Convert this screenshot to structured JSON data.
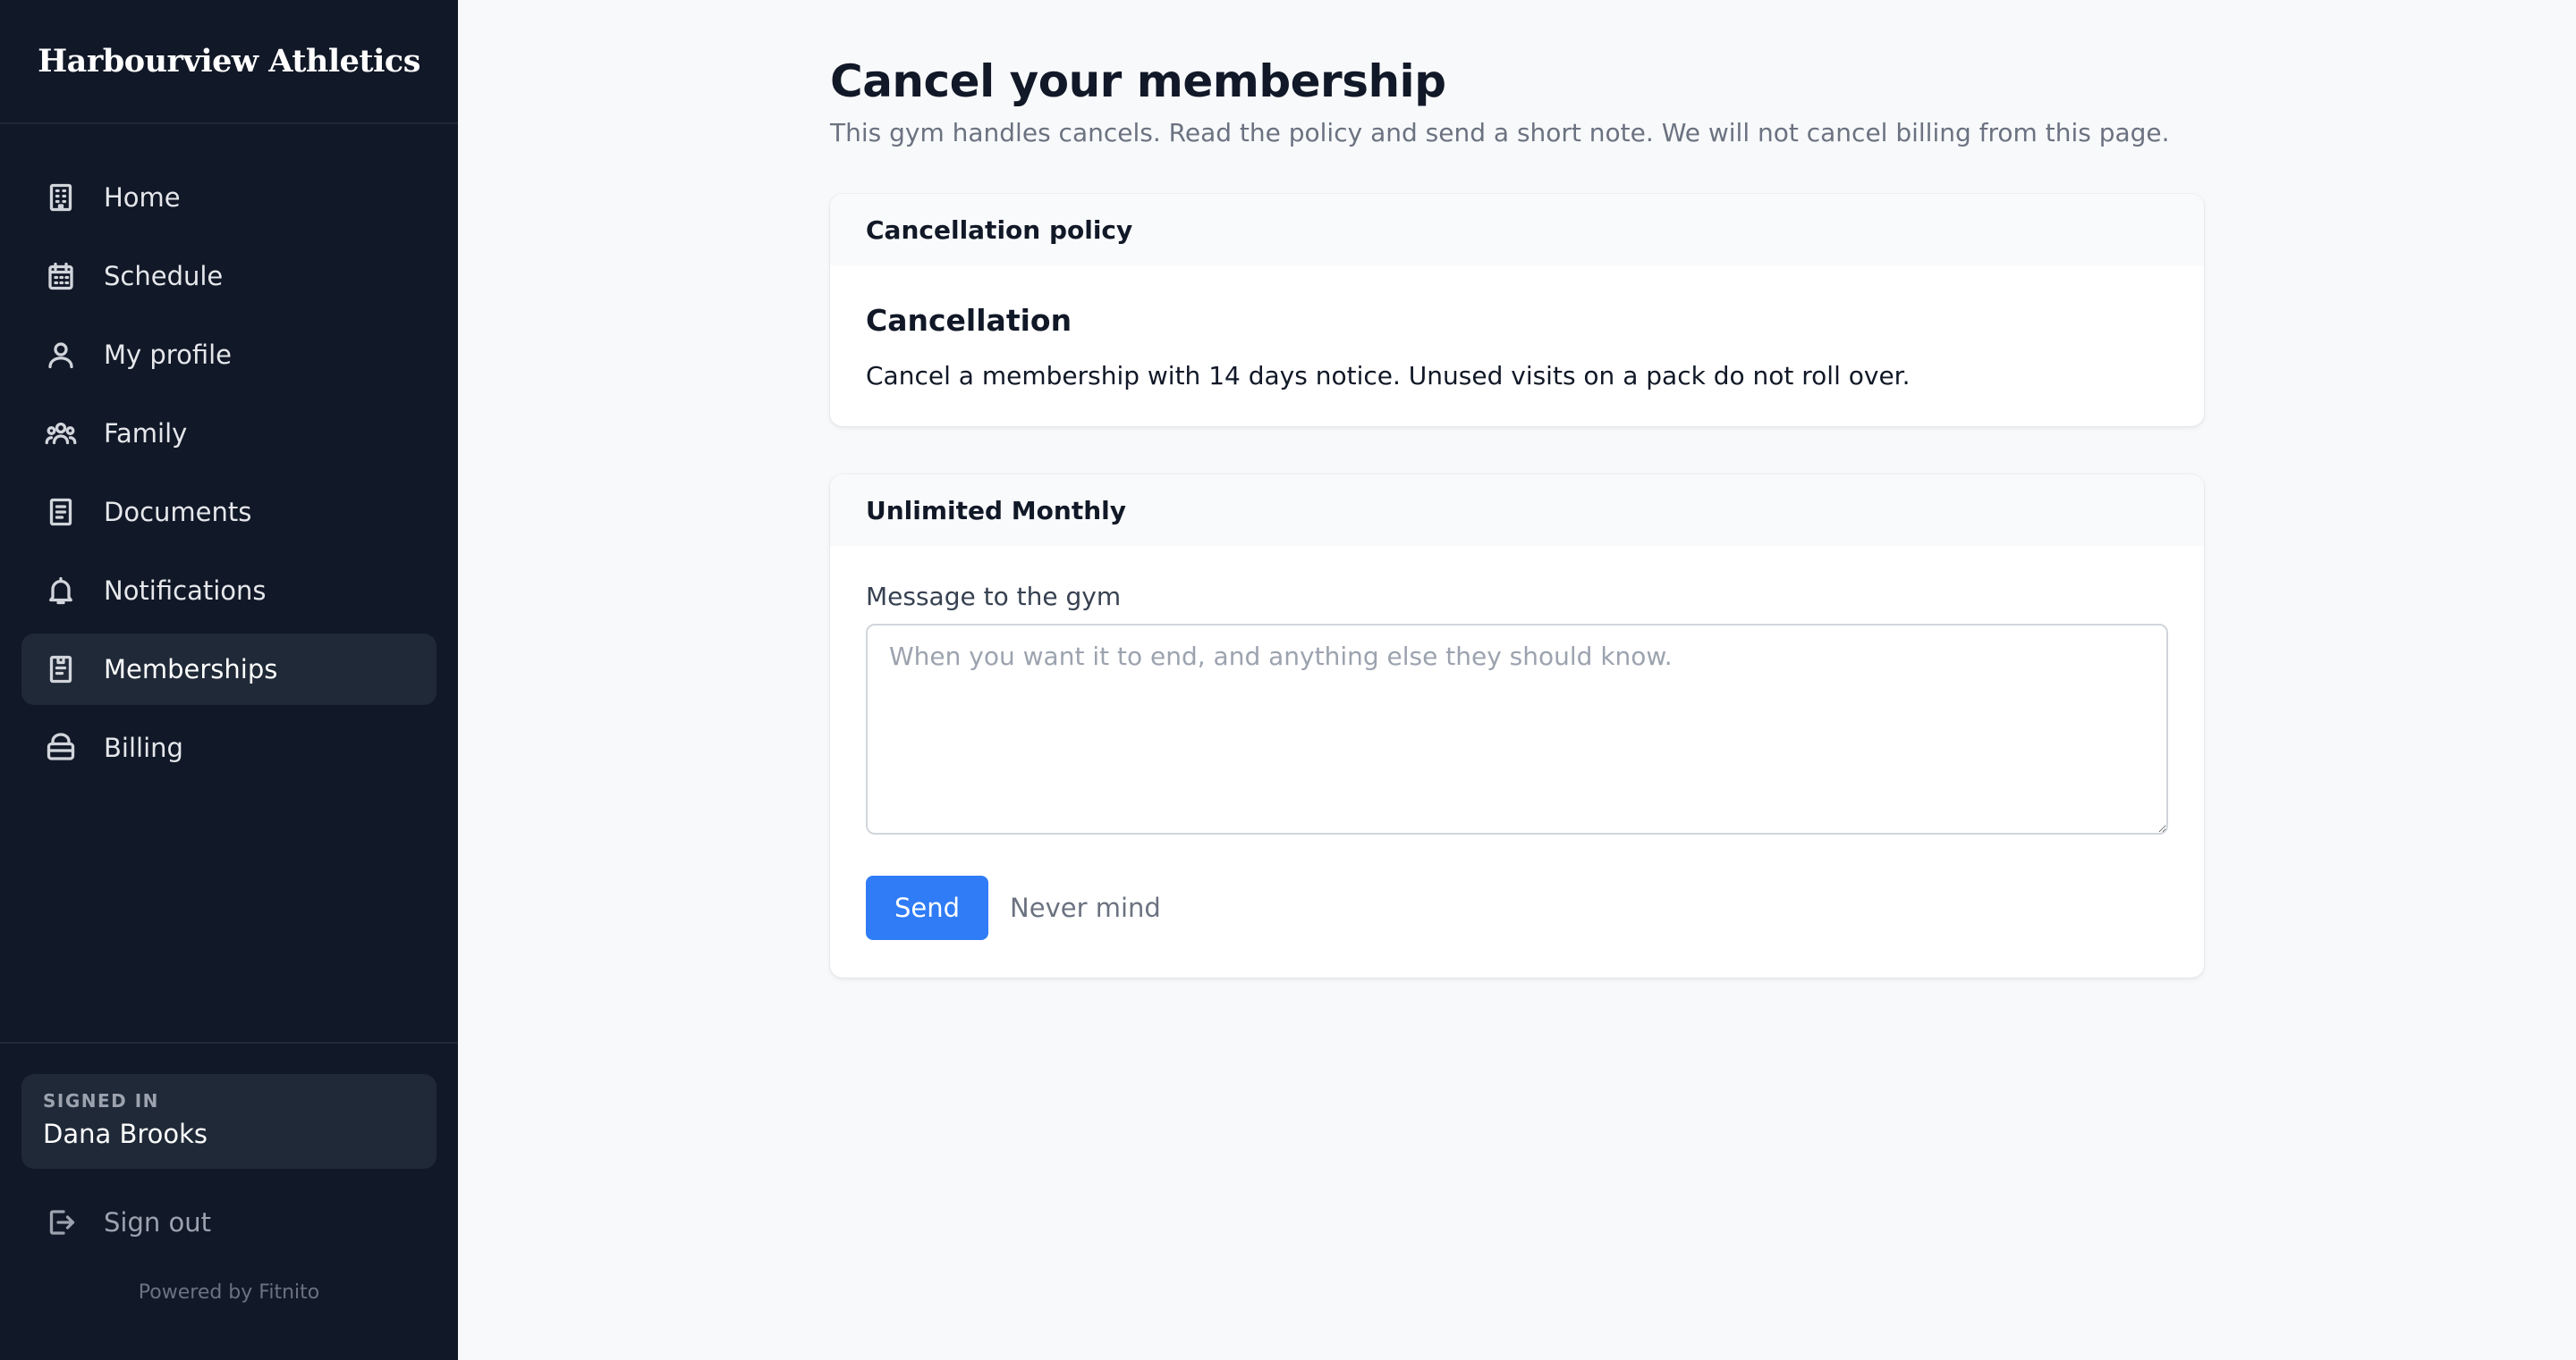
{
  "brand": {
    "name": "Harbourview Athletics"
  },
  "sidebar": {
    "items": [
      {
        "label": "Home",
        "icon": "building-icon"
      },
      {
        "label": "Schedule",
        "icon": "calendar-icon"
      },
      {
        "label": "My profile",
        "icon": "user-icon"
      },
      {
        "label": "Family",
        "icon": "users-icon"
      },
      {
        "label": "Documents",
        "icon": "document-icon"
      },
      {
        "label": "Notifications",
        "icon": "bell-icon"
      },
      {
        "label": "Memberships",
        "icon": "clipboard-icon",
        "active": true
      },
      {
        "label": "Billing",
        "icon": "wallet-icon"
      }
    ],
    "signed_in_label": "SIGNED IN",
    "user_name": "Dana Brooks",
    "sign_out_label": "Sign out",
    "powered_by": "Powered by Fitnito"
  },
  "page": {
    "title": "Cancel your membership",
    "subtitle": "This gym handles cancels. Read the policy and send a short note. We will not cancel billing from this page."
  },
  "policy_card": {
    "header": "Cancellation policy",
    "heading": "Cancellation",
    "text": "Cancel a membership with 14 days notice. Unused visits on a pack do not roll over."
  },
  "membership_card": {
    "header": "Unlimited Monthly",
    "message_label": "Message to the gym",
    "message_value": "",
    "message_placeholder": "When you want it to end, and anything else they should know.",
    "send_label": "Send",
    "cancel_label": "Never mind"
  },
  "colors": {
    "sidebar_bg": "#111827",
    "sidebar_active": "#1f2937",
    "accent": "#2f7cf6",
    "page_bg": "#f8f9fb"
  }
}
